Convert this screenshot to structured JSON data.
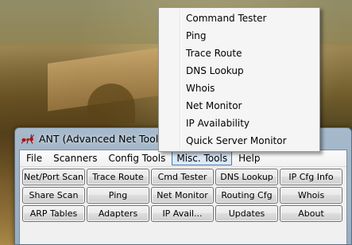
{
  "window": {
    "title": "ANT (Advanced Net Tools) 2."
  },
  "menubar": {
    "items": [
      "File",
      "Scanners",
      "Config Tools",
      "Misc. Tools",
      "Help"
    ],
    "active": "Misc. Tools"
  },
  "dropdown": {
    "items": [
      "Command Tester",
      "Ping",
      "Trace Route",
      "DNS Lookup",
      "Whois",
      "Net Monitor",
      "IP Availability",
      "Quick Server Monitor"
    ]
  },
  "buttons": {
    "row1": [
      "Net/Port Scan",
      "Trace Route",
      "Cmd Tester",
      "DNS Lookup",
      "IP Cfg Info"
    ],
    "row2": [
      "Share Scan",
      "Ping",
      "Net Monitor",
      "Routing Cfg",
      "Whois"
    ],
    "row3": [
      "ARP Tables",
      "Adapters",
      "IP Avail...",
      "Updates",
      "About"
    ]
  },
  "icons": {
    "app": "ant-icon"
  },
  "colors": {
    "menu_active_border": "#4a78b0",
    "menu_active_bg": "#dbe8f7",
    "titlebar": "#adc4da"
  }
}
